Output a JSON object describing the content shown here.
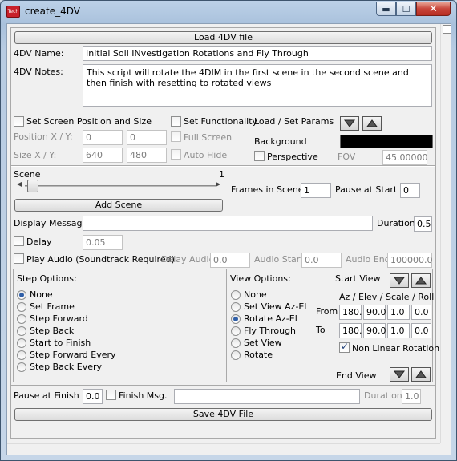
{
  "window": {
    "title": "create_4DV",
    "app_icon_text": "Tech",
    "minimize_glyph": "▬",
    "maximize_glyph": "☐",
    "close_glyph": "✕"
  },
  "load_button": "Load 4DV file",
  "name": {
    "label": "4DV Name:",
    "value": "Initial Soil INvestigation Rotations and Fly Through"
  },
  "notes": {
    "label": "4DV Notes:",
    "value": "This script will rotate the 4DIM in the first scene in the second scene and then finish with resetting to rotated views"
  },
  "screen": {
    "set_position_label": "Set Screen Position and Size",
    "position_label": "Position X / Y:",
    "pos_x": "0",
    "pos_y": "0",
    "size_label": "Size X / Y:",
    "size_x": "640",
    "size_y": "480",
    "set_functionality_label": "Set Functionality",
    "full_screen_label": "Full Screen",
    "auto_hide_label": "Auto Hide"
  },
  "params": {
    "load_set_label": "Load / Set Params",
    "background_label": "Background",
    "background_color": "#000000",
    "perspective_label": "Perspective",
    "fov_label": "FOV",
    "fov_value": "45.00000"
  },
  "scene": {
    "label": "Scene",
    "number": "1",
    "slider_fraction": 0.0,
    "frames_label": "Frames in Scene",
    "frames_value": "1",
    "pause_start_label": "Pause at Start",
    "pause_start_value": "0",
    "add_scene_label": "Add Scene"
  },
  "display_message": {
    "label": "Display Message",
    "value": "",
    "duration_label": "Duration",
    "duration_value": "0.5"
  },
  "delay": {
    "label": "Delay",
    "value": "0.05"
  },
  "audio": {
    "play_label": "Play Audio (Soundtrack Required)",
    "delay_label": "Delay Audio",
    "delay_value": "0.0",
    "start_label": "Audio Start",
    "start_value": "0.0",
    "end_label": "Audio End",
    "end_value": "100000.0"
  },
  "step_options": {
    "title": "Step Options:",
    "items": [
      "None",
      "Set Frame",
      "Step Forward",
      "Step Back",
      "Start to Finish",
      "Step Forward Every",
      "Step Back Every"
    ],
    "selected": 0
  },
  "view_options": {
    "title": "View Options:",
    "items": [
      "None",
      "Set View Az-El",
      "Rotate Az-El",
      "Fly Through",
      "Set View",
      "Rotate"
    ],
    "selected": 2,
    "start_view_label": "Start View",
    "end_view_label": "End View",
    "header": "Az / Elev / Scale / Roll",
    "from_label": "From",
    "from_values": [
      "180.",
      "90.0",
      "1.0",
      "0.0"
    ],
    "to_label": "To",
    "to_values": [
      "180.",
      "90.0",
      "1.0",
      "0.0"
    ],
    "nonlinear_label": "Non Linear Rotation"
  },
  "finish": {
    "pause_label": "Pause at Finish",
    "pause_value": "0.0",
    "msg_label": "Finish Msg.",
    "msg_value": "",
    "duration_label": "Duration",
    "duration_value": "1.0"
  },
  "save_button": "Save 4DV File"
}
